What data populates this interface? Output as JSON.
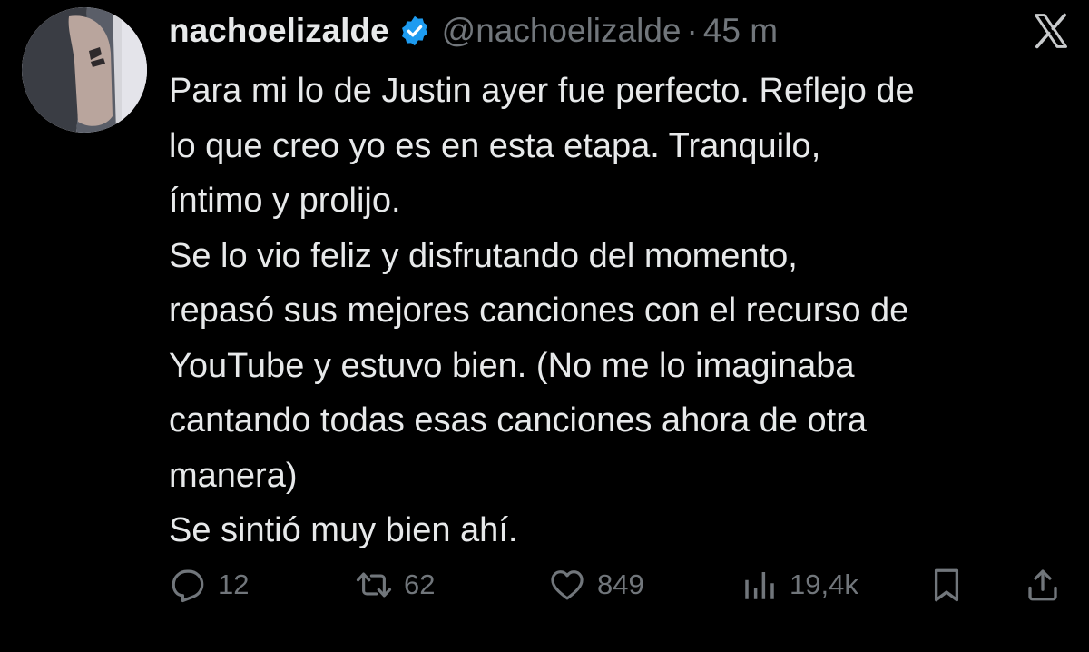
{
  "tweet": {
    "display_name": "nachoelizalde",
    "handle": "@nachoelizalde",
    "separator": "·",
    "time": "45 m",
    "verified": true,
    "text_lines": [
      "Para mi lo de Justin ayer fue perfecto. Reflejo de",
      "lo que creo yo es en esta etapa. Tranquilo,",
      "íntimo y prolijo.",
      "Se lo vio feliz y disfrutando del momento,",
      "repasó sus mejores canciones con el recurso de",
      "YouTube y estuvo bien. (No me lo imaginaba",
      "cantando todas esas canciones ahora de otra",
      "manera)",
      "Se sintió muy bien ahí."
    ]
  },
  "actions": {
    "replies": "12",
    "retweets": "62",
    "likes": "849",
    "views": "19,4k"
  },
  "icons": {
    "verified": "verified-badge-icon",
    "brand": "x-logo-icon",
    "reply": "reply-icon",
    "retweet": "retweet-icon",
    "like": "heart-icon",
    "views": "views-icon",
    "bookmark": "bookmark-icon",
    "share": "share-icon"
  },
  "colors": {
    "background": "#000000",
    "text": "#e7e9ea",
    "secondary": "#71767b",
    "verified": "#1d9bf0"
  }
}
